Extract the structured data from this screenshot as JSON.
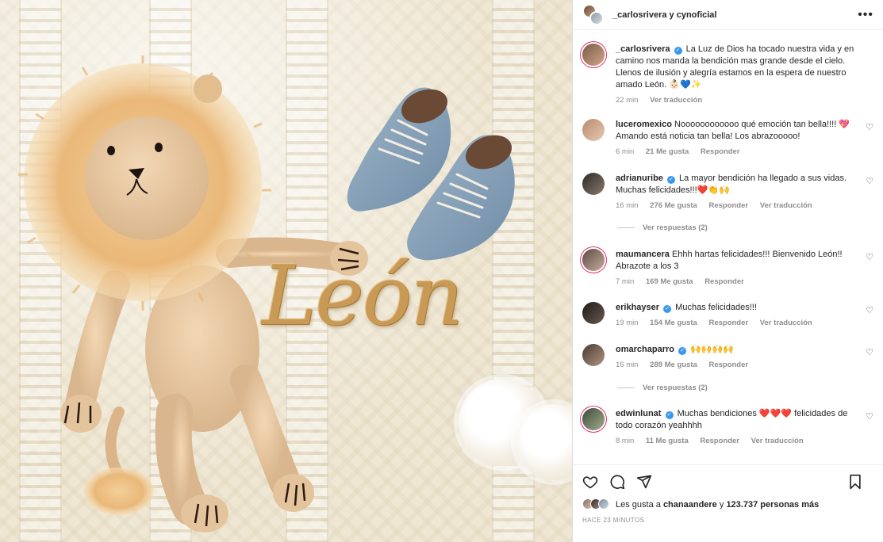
{
  "header": {
    "title": "_carlosrivera y cynoficial"
  },
  "photo": {
    "embroidered_name": "León"
  },
  "caption": {
    "user": "_carlosrivera",
    "text": "La Luz de Dios ha tocado nuestra vida y en camino nos manda la bendición mas grande desde el cielo. Llenos de ilusión y alegría estamos en la espera de nuestro amado León. 👶🏻💙✨",
    "time": "22 min",
    "translate": "Ver traducción"
  },
  "comments": [
    {
      "user": "luceromexico",
      "verified": false,
      "text": "Noooooooooooo qué emoción tan bella!!!! 💖 Amando está noticia tan bella! Los abrazooooo!",
      "time": "6 min",
      "likes": "21 Me gusta",
      "reply": "Responder",
      "translate": ""
    },
    {
      "user": "adrianuribe",
      "verified": true,
      "text": "La mayor bendición ha llegado a sus vidas. Muchas felicidades!!!❤️👏🙌",
      "time": "16 min",
      "likes": "276 Me gusta",
      "reply": "Responder",
      "translate": "Ver traducción"
    },
    {
      "user": "maumancera",
      "verified": false,
      "text": "Ehhh hartas felicidades!!! Bienvenido León!! Abrazote a los 3",
      "time": "7 min",
      "likes": "169 Me gusta",
      "reply": "Responder",
      "translate": ""
    },
    {
      "user": "erikhayser",
      "verified": true,
      "text": "Muchas felicidades!!!",
      "time": "19 min",
      "likes": "154 Me gusta",
      "reply": "Responder",
      "translate": "Ver traducción"
    },
    {
      "user": "omarchaparro",
      "verified": true,
      "text": "🙌🙌🙌🙌",
      "time": "16 min",
      "likes": "289 Me gusta",
      "reply": "Responder",
      "translate": ""
    },
    {
      "user": "edwinlunat",
      "verified": true,
      "text": "Muchas bendiciones ❤️❤️❤️ felicidades de todo corazón yeahhhh",
      "time": "8 min",
      "likes": "11 Me gusta",
      "reply": "Responder",
      "translate": "Ver traducción"
    }
  ],
  "view_replies": [
    "Ver respuestas (2)",
    "Ver respuestas (2)"
  ],
  "footer": {
    "likes_prefix": "Les gusta a ",
    "likes_user": "chanaandere",
    "likes_mid": " y ",
    "likes_count": "123.737 personas más",
    "posted_ago": "HACE 23 MINUTOS"
  },
  "icons": {
    "heart": "heart-icon",
    "comment": "comment-icon",
    "share": "share-icon",
    "save": "bookmark-icon",
    "more": "more-icon",
    "verified": "verified-icon"
  },
  "colors": {
    "verified_blue": "#3897f0",
    "meta_gray": "#8e8e8e",
    "text": "#262626",
    "embroidery_gold": "#c99a55",
    "shoe_blue": "#7f9bb4"
  }
}
